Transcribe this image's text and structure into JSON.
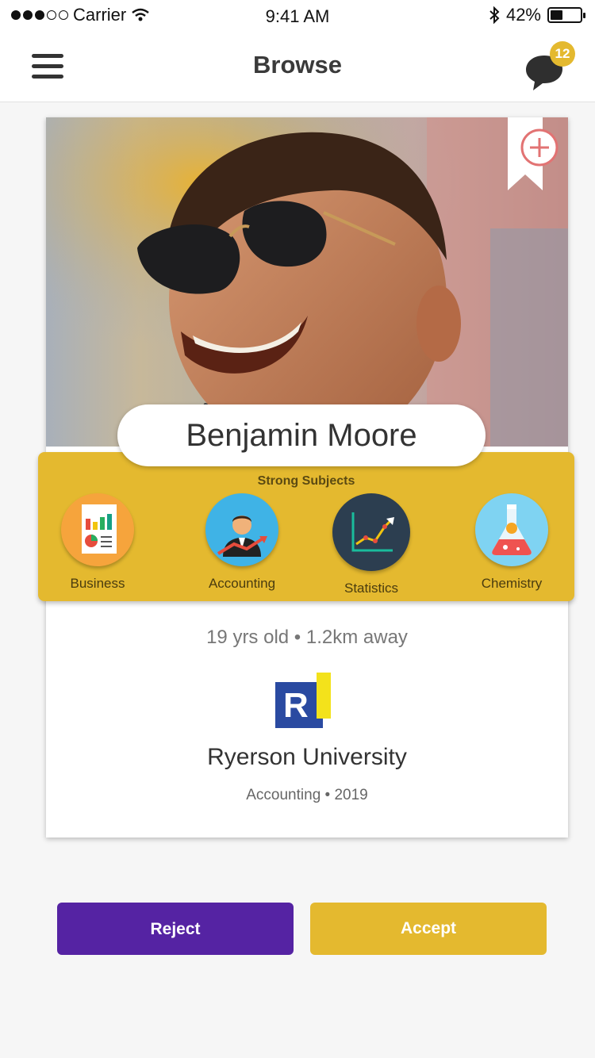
{
  "status_bar": {
    "carrier": "Carrier",
    "time": "9:41 AM",
    "battery": "42%",
    "battery_level": 0.42
  },
  "nav": {
    "title": "Browse",
    "message_count": "12",
    "icons": [
      "hamburger-menu-icon",
      "chat-bubble-icon"
    ]
  },
  "profile": {
    "name": "Benjamin Moore",
    "meta": "19 yrs old • 1.2km away",
    "university": "Ryerson University",
    "university_logo_letter": "R",
    "program": "Accounting • 2019"
  },
  "subjects": {
    "title": "Strong Subjects",
    "items": [
      {
        "label": "Business",
        "icon": "business-report-icon",
        "color": "#f6a43c"
      },
      {
        "label": "Accounting",
        "icon": "accounting-person-icon",
        "color": "#3fb3e6"
      },
      {
        "label": "Statistics",
        "icon": "statistics-chart-icon",
        "color": "#2c3e50"
      },
      {
        "label": "Chemistry",
        "icon": "chemistry-flask-icon",
        "color": "#7fd3f2"
      }
    ]
  },
  "actions": {
    "reject": "Reject",
    "accept": "Accept"
  },
  "colors": {
    "accent": "#e4b92f",
    "reject": "#5523a3"
  }
}
